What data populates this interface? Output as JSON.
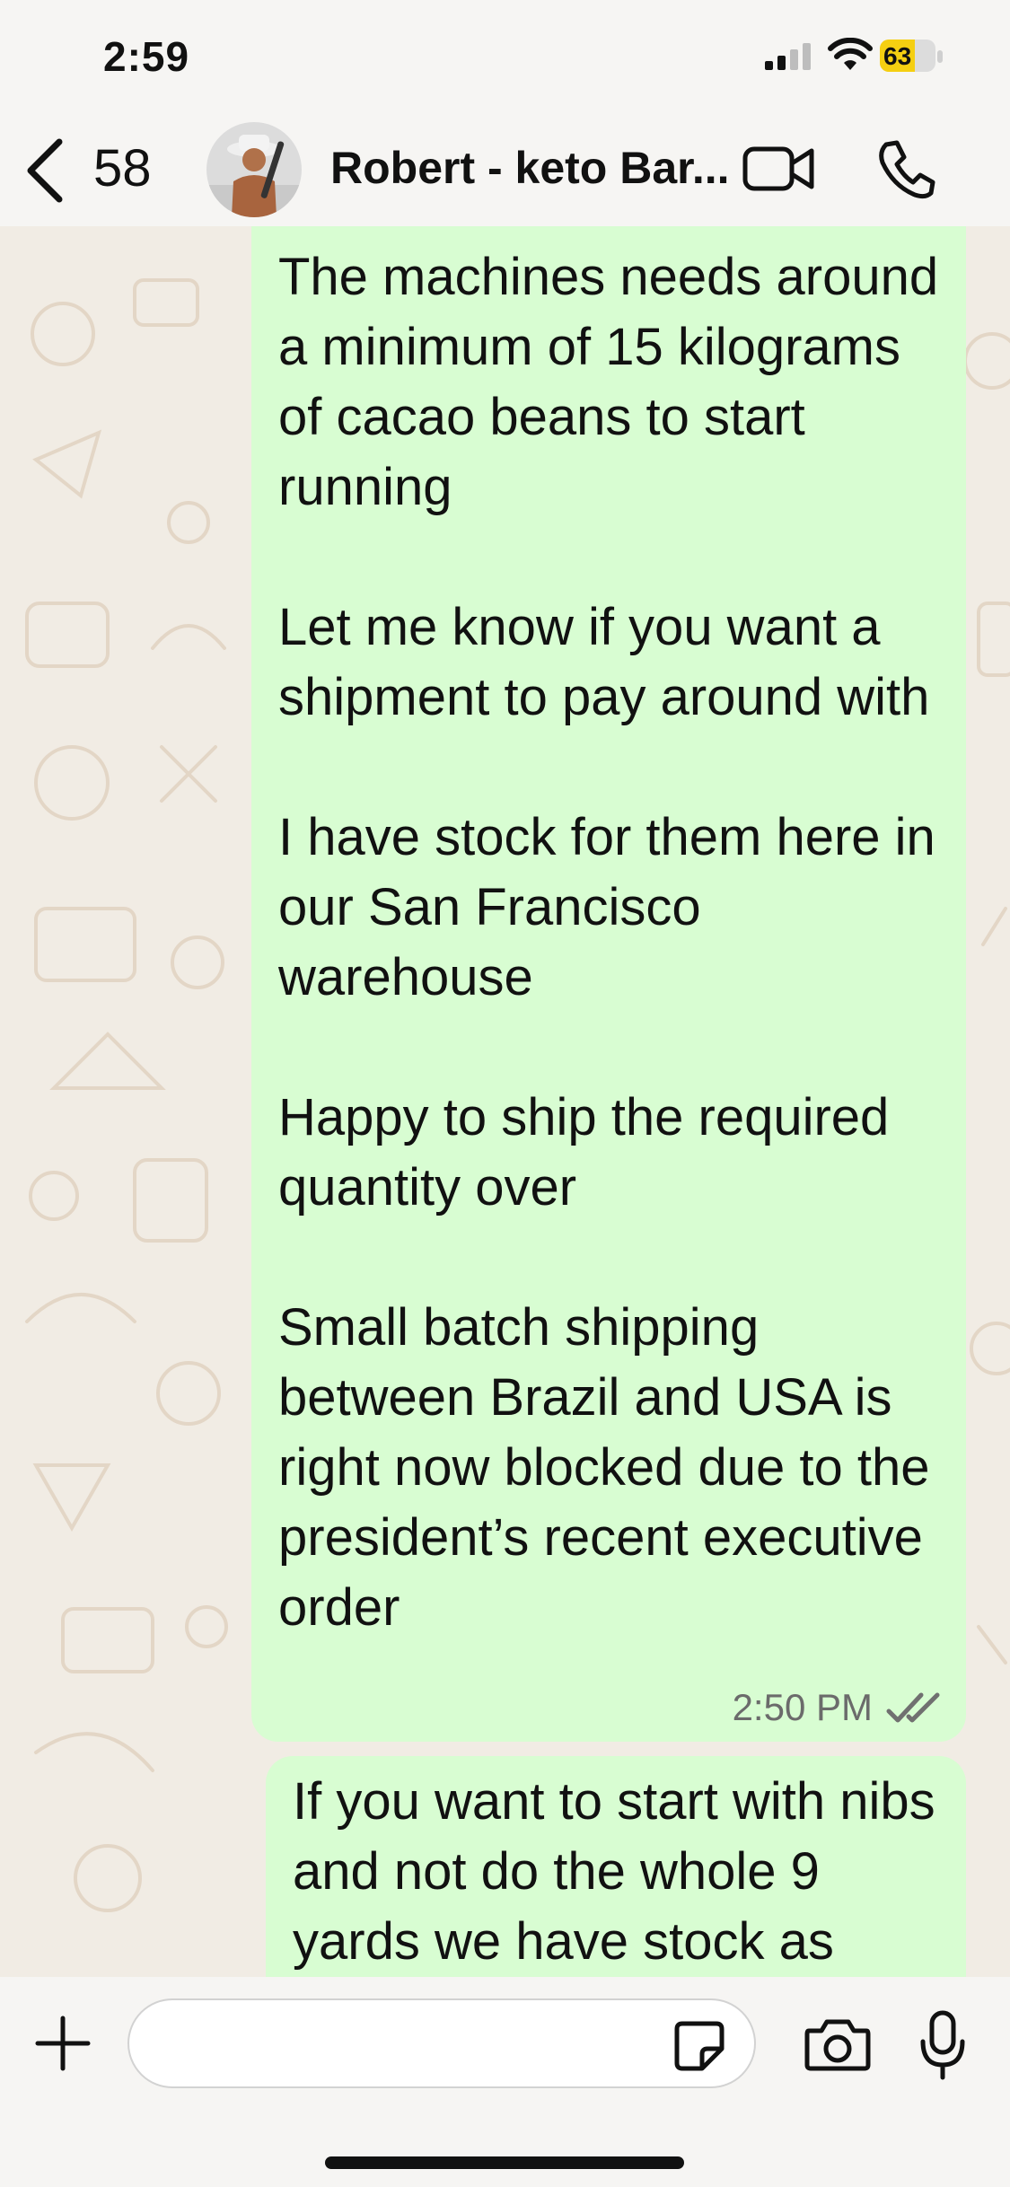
{
  "status_bar": {
    "time": "2:59",
    "battery": "63",
    "battery_level": 0.63,
    "battery_color": "#f5cf11"
  },
  "header": {
    "unread_count": "58",
    "contact_name": "Robert - keto Bar...",
    "icons": [
      "chevron-left-icon",
      "video-icon",
      "phone-icon"
    ]
  },
  "messages": [
    {
      "direction": "outgoing",
      "text": "The machines needs around a minimum of 15 kilograms of cacao beans to start running\n\nLet me know if you want a shipment to pay around with\n\nI have stock for them here in our San Francisco warehouse\n\nHappy to ship the required quantity over\n\nSmall batch shipping between Brazil and USA is right now blocked due to the president’s recent executive order",
      "time": "2:50 PM",
      "status": "read"
    },
    {
      "direction": "outgoing",
      "text": "If you want to start with nibs and not do the whole 9 yards we have stock as"
    }
  ],
  "composer": {
    "placeholder": "",
    "icons": [
      "plus-icon",
      "sticker-icon",
      "camera-icon",
      "microphone-icon"
    ]
  },
  "colors": {
    "bubble_outgoing": "#d8fdd2",
    "chat_background": "#f1ece4",
    "bar_background": "#f6f5f3"
  }
}
